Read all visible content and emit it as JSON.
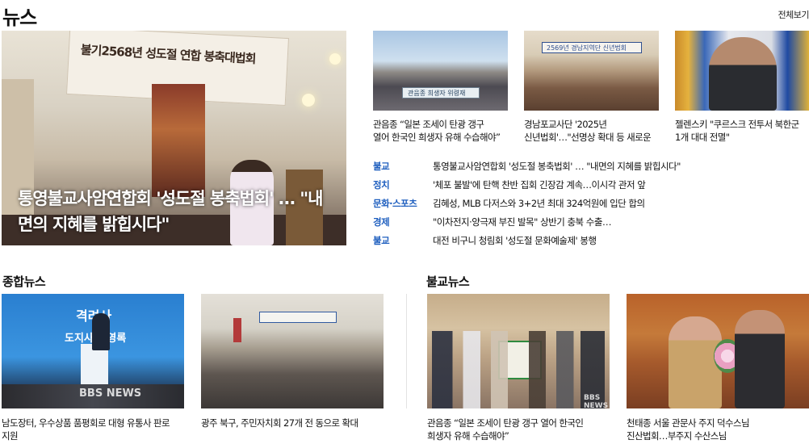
{
  "header": {
    "title": "뉴스",
    "view_all": "전체보기"
  },
  "hero": {
    "caption": "통영불교사암연합회 '성도절 봉축법회' … \"내면의 지혜를 밝힙시다\"",
    "banner_text": "불기2568년 성도절 연합 봉축대법회"
  },
  "thumbs": [
    {
      "caption_line1": "관음종 “일본 조세이 탄광 갱구",
      "caption_line2": "열어 한국인 희생자 유해 수습해야”",
      "banner_text": "관음종 희생자 위령재"
    },
    {
      "caption_line1": "경남포교사단 '2025년",
      "caption_line2": "신년법회'…\"선명상 확대 등 새로운",
      "banner_text": "2569년 경남지역단 신년법회"
    },
    {
      "caption_line1": "젤렌스키 \"쿠르스크 전투서 북한군",
      "caption_line2": "1개 대대 전멸\""
    }
  ],
  "headlines": [
    {
      "category": "불교",
      "title": "통영불교사암연합회 '성도절 봉축법회' … \"내면의 지혜를 밝힙시다\""
    },
    {
      "category": "정치",
      "title": "'체포 불발'에 탄핵 찬반 집회 긴장감 계속…이시각 관저 앞"
    },
    {
      "category": "문화·스포츠",
      "title": "김혜성, MLB 다저스와 3+2년 최대 324억원에 입단 합의"
    },
    {
      "category": "경제",
      "title": "\"이차전지·양극재 부진 발목\" 상반기 충북 수출…"
    },
    {
      "category": "불교",
      "title": "대전 비구니 청림회 '성도절 문화예술제' 봉행"
    }
  ],
  "sections": {
    "general": {
      "title": "종합뉴스"
    },
    "buddhist": {
      "title": "불교뉴스"
    }
  },
  "cards": [
    {
      "caption_line1": "남도장터, 우수상품 품평회로 대형 유통사 판로",
      "caption_line2": "지원",
      "sign_text": "격려사",
      "screen_text": "도지사 김영록",
      "logo": "BBS NEWS"
    },
    {
      "caption_line1": "광주 북구, 주민자치회 27개 전 동으로 확대",
      "caption_line2": ""
    },
    {
      "caption_line1": "관음종 “일본 조세이 탄광 갱구 열어 한국인",
      "caption_line2": "희생자 유해 수습해야”",
      "logo": "BBS NEWS"
    },
    {
      "caption_line1": "천태종 서울 관문사 주지 덕수스님",
      "caption_line2": "진산법회…부주지 수산스님"
    }
  ]
}
